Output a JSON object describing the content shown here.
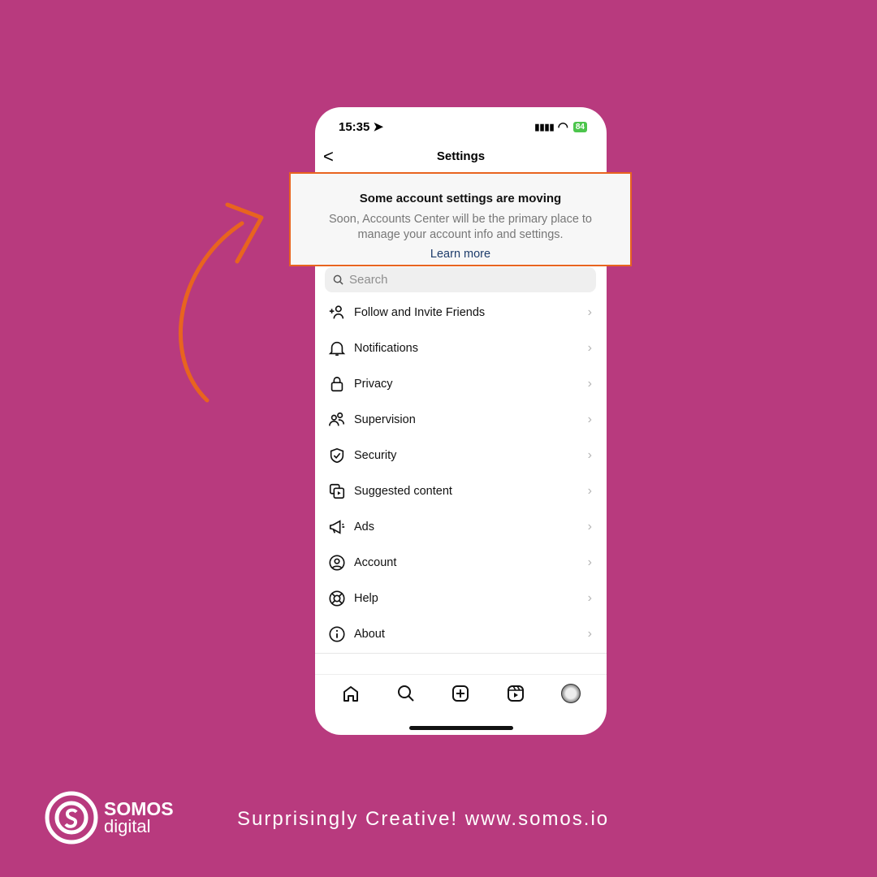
{
  "status": {
    "time": "15:35",
    "battery": "84"
  },
  "header": {
    "title": "Settings",
    "back": "<"
  },
  "banner": {
    "title": "Some account settings are moving",
    "line1": "Soon, Accounts Center will be the primary place to",
    "line2": "manage your account info and settings.",
    "link": "Learn more",
    "border_color": "#e8641f"
  },
  "search": {
    "placeholder": "Search"
  },
  "items": [
    {
      "label": "Follow and Invite Friends",
      "icon": "add-person-icon"
    },
    {
      "label": "Notifications",
      "icon": "bell-icon"
    },
    {
      "label": "Privacy",
      "icon": "lock-icon"
    },
    {
      "label": "Supervision",
      "icon": "people-icon"
    },
    {
      "label": "Security",
      "icon": "shield-icon"
    },
    {
      "label": "Suggested content",
      "icon": "media-icon"
    },
    {
      "label": "Ads",
      "icon": "megaphone-icon"
    },
    {
      "label": "Account",
      "icon": "user-circle-icon"
    },
    {
      "label": "Help",
      "icon": "lifebuoy-icon"
    },
    {
      "label": "About",
      "icon": "info-icon"
    }
  ],
  "tabbar": [
    "home-icon",
    "search-icon",
    "create-icon",
    "reels-icon",
    "profile-avatar"
  ],
  "footer": {
    "brand1": "SOMOS",
    "brand2": "digital",
    "tagline": "Surprisingly Creative!  www.somos.io"
  },
  "colors": {
    "background": "#b83a7e",
    "accent": "#e8641f"
  }
}
